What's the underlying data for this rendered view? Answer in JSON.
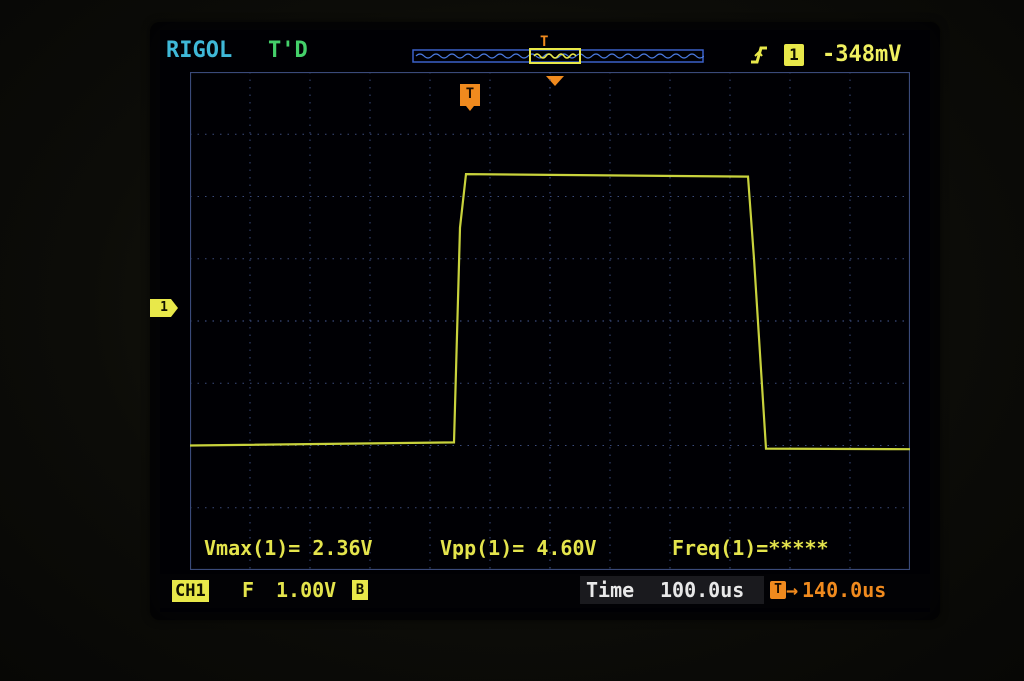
{
  "header": {
    "brand": "RIGOL",
    "trigger_status": "T'D",
    "trigger_channel": "1",
    "trigger_level": "-348mV",
    "trigger_marker": "T"
  },
  "channel_marker": "1",
  "measurements": {
    "vmax": "Vmax(1)= 2.36V",
    "vpp": "Vpp(1)= 4.60V",
    "freq": "Freq(1)=*****"
  },
  "status": {
    "channel": "CH1",
    "coupling": "F",
    "volts_per_div": "1.00V",
    "bw_limit": "B",
    "time_label": "Time",
    "time_value": "100.0us",
    "offset_marker": "T",
    "offset_arrow": "→",
    "offset_value": "140.0us"
  },
  "colors": {
    "trace": "#c8d23c",
    "grid": "#3a4a7a",
    "brand": "#3fb8d8",
    "trigger": "#f08a1e",
    "channel": "#e8e84a"
  },
  "chart_data": {
    "type": "line",
    "grid": true,
    "x_divisions": 12,
    "y_divisions": 8,
    "xlim": [
      -600,
      600
    ],
    "ylim": [
      -4,
      4
    ],
    "series": [
      {
        "x": [
          -600,
          -160,
          -150,
          -140,
          330,
          340,
          360,
          600
        ],
        "y": [
          -2.0,
          -1.95,
          1.5,
          2.36,
          2.32,
          1.0,
          -2.05,
          -2.06
        ]
      }
    ]
  }
}
